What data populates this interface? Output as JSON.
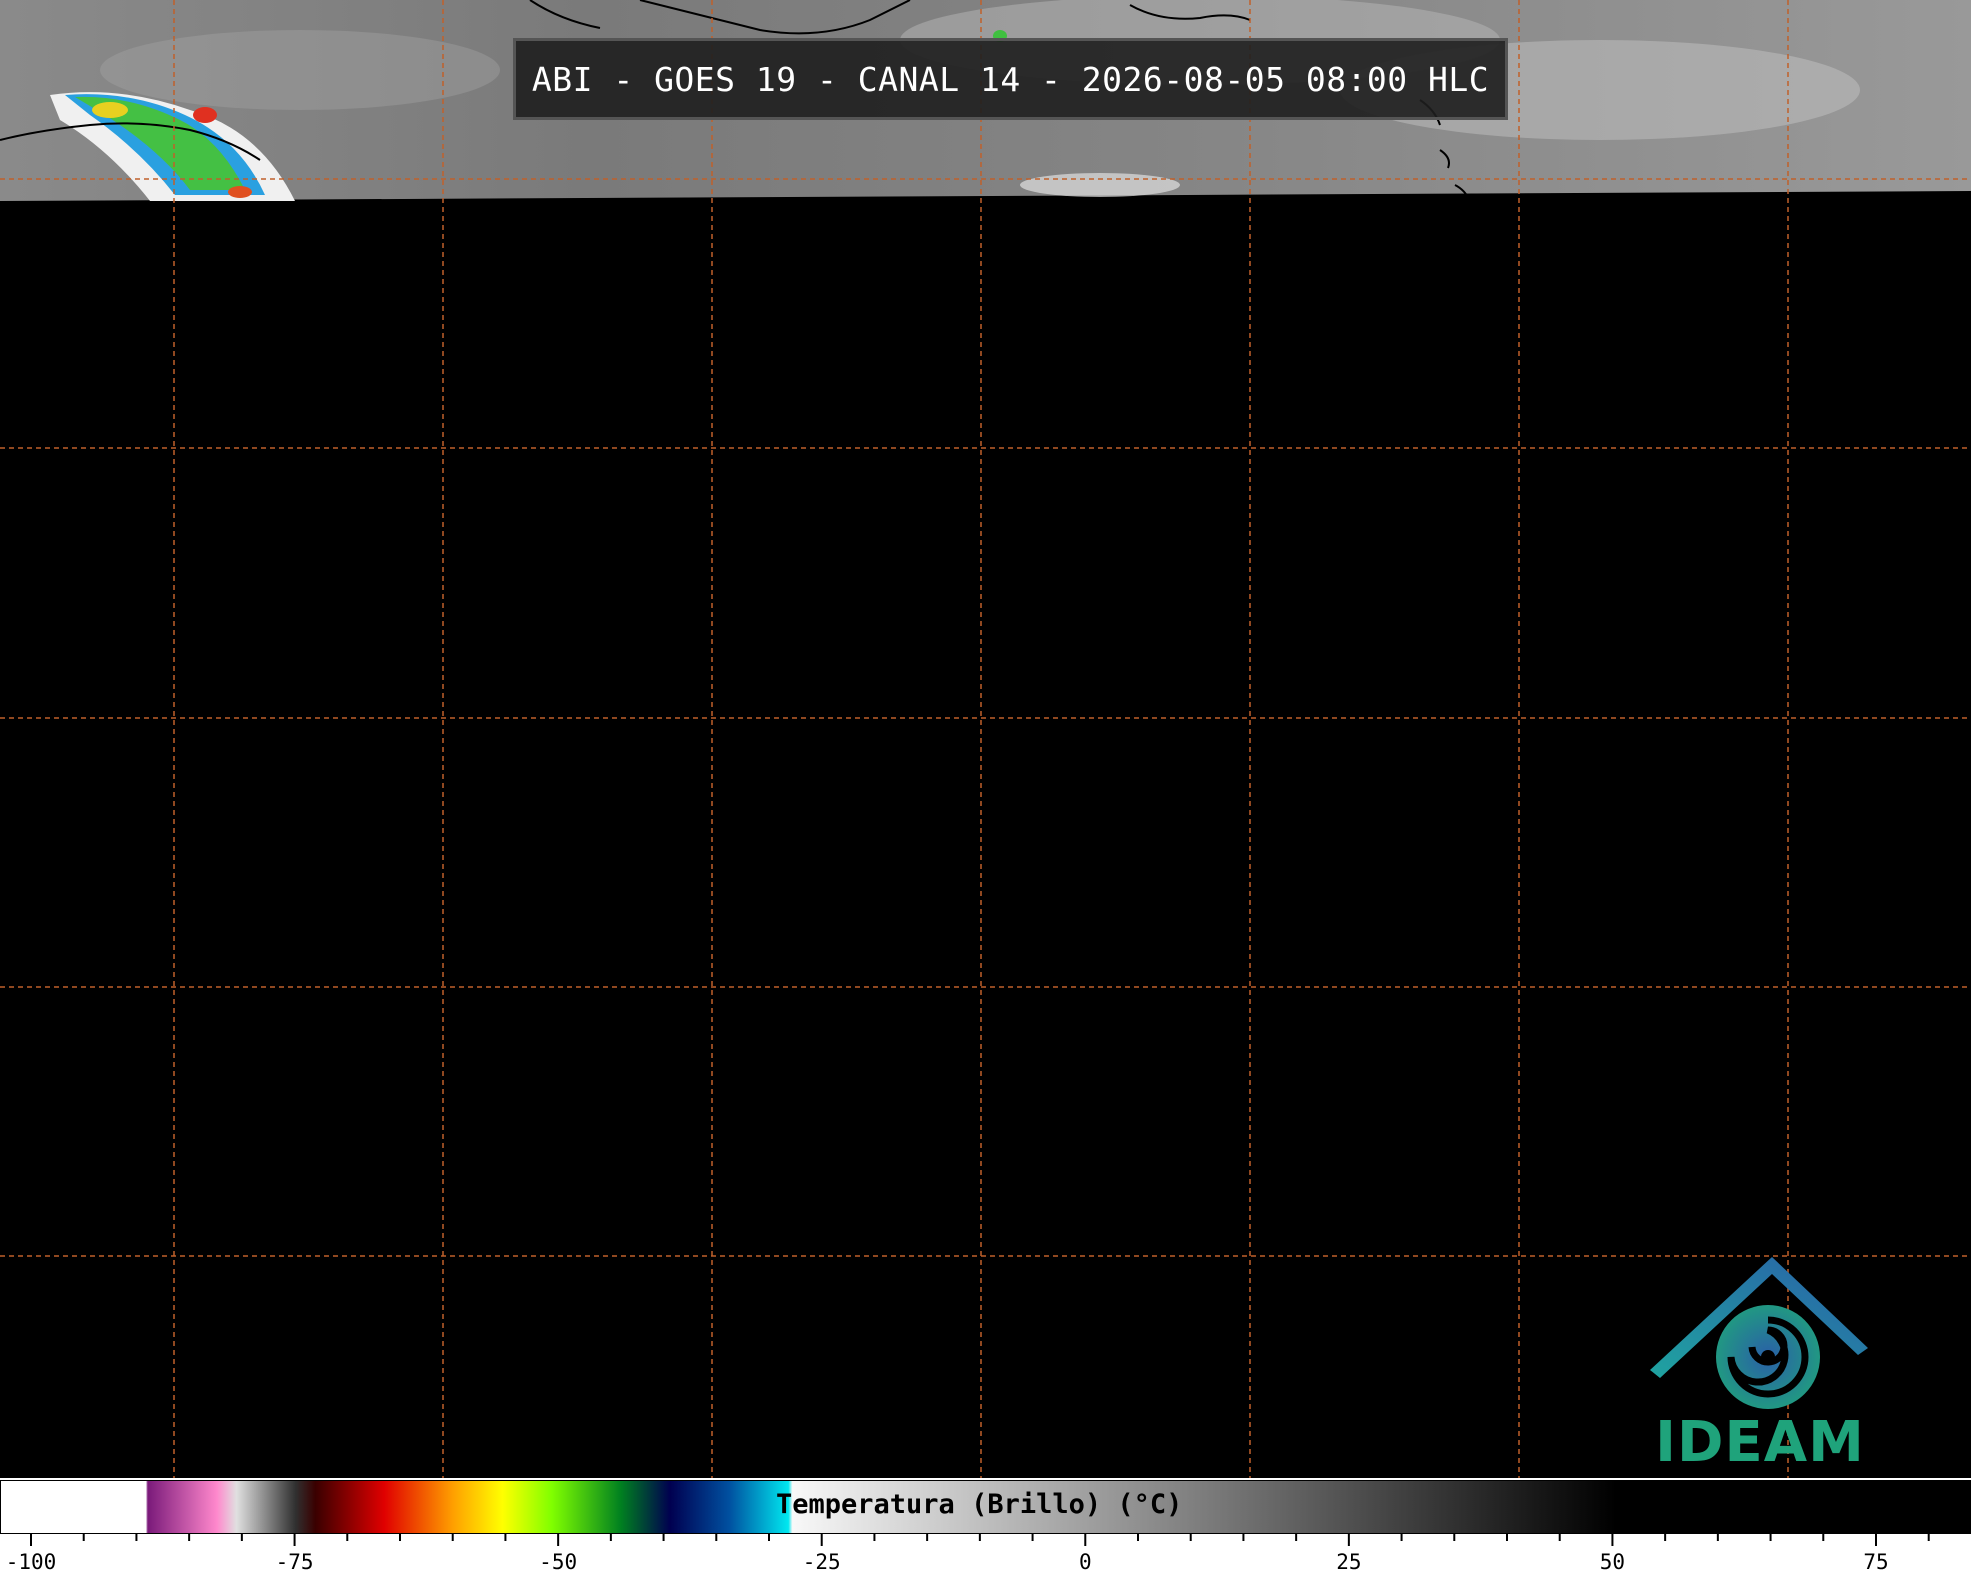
{
  "title": "ABI - GOES 19 - CANAL 14 - 2026-08-05 08:00 HLC",
  "logo": {
    "text": "IDEAM",
    "color": "#1fa37b",
    "icon": "ideam-house-swirl-icon"
  },
  "colorbar": {
    "label": "Temperatura (Brillo) (°C)",
    "ticks": [
      "-100",
      "-75",
      "-50",
      "-25",
      "0",
      "25",
      "50",
      "75"
    ],
    "range": [
      -103,
      83
    ]
  },
  "grid": {
    "color": "#c0602a",
    "style": "dashed"
  }
}
